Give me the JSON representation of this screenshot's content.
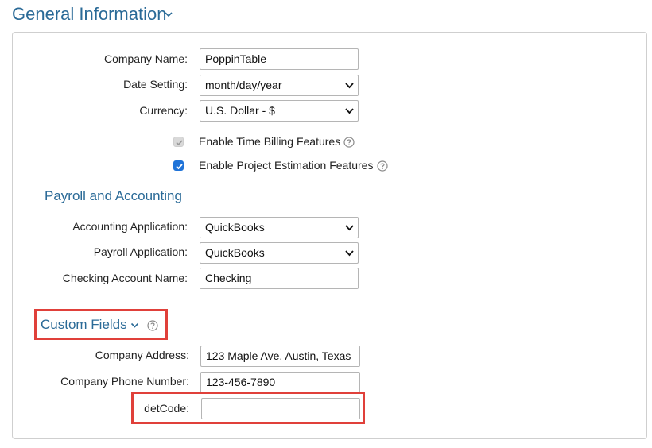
{
  "header": {
    "title": "General Information",
    "chevron_icon": "chevron-down-icon"
  },
  "general": {
    "company_name": {
      "label": "Company Name:",
      "value": "PoppinTable"
    },
    "date_setting": {
      "label": "Date Setting:",
      "value": "month/day/year"
    },
    "currency": {
      "label": "Currency:",
      "value": "U.S. Dollar - $"
    },
    "time_billing": {
      "label": "Enable Time Billing Features",
      "checked": true,
      "disabled": true
    },
    "project_estimation": {
      "label": "Enable Project Estimation Features",
      "checked": true,
      "disabled": false
    }
  },
  "payroll": {
    "title": "Payroll and Accounting",
    "accounting_app": {
      "label": "Accounting Application:",
      "value": "QuickBooks"
    },
    "payroll_app": {
      "label": "Payroll Application:",
      "value": "QuickBooks"
    },
    "checking_account": {
      "label": "Checking Account Name:",
      "value": "Checking"
    }
  },
  "custom_fields": {
    "title": "Custom Fields",
    "company_address": {
      "label": "Company Address:",
      "value": "123 Maple Ave,  Austin, Texas"
    },
    "company_phone": {
      "label": "Company Phone Number:",
      "value": "123-456-7890"
    },
    "det_code": {
      "label": "detCode:",
      "value": ""
    }
  },
  "colors": {
    "accent": "#2a6a97",
    "highlight": "#e0403a",
    "checkbox": "#1f73d8"
  }
}
